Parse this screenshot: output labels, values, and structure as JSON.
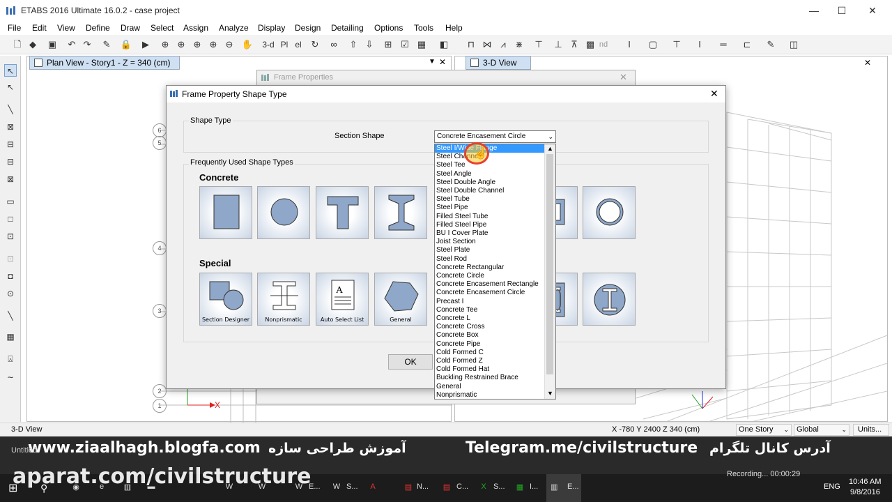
{
  "app": {
    "title": "ETABS 2016 Ultimate 16.0.2 - case project",
    "window_controls": [
      "—",
      "☐",
      "✕"
    ]
  },
  "menu": [
    "File",
    "Edit",
    "View",
    "Define",
    "Draw",
    "Select",
    "Assign",
    "Analyze",
    "Display",
    "Design",
    "Detailing",
    "Options",
    "Tools",
    "Help"
  ],
  "toolbar": {
    "label_3d": "3-d",
    "label_pl": "Pl",
    "label_el": "el",
    "label_nd": "nd"
  },
  "tabs": {
    "plan": "Plan View - Story1 - Z = 340 (cm)",
    "view3d": "3-D View"
  },
  "plan_grid": {
    "bubbles": [
      "6",
      "5",
      "4",
      "3",
      "2",
      "1"
    ],
    "axis_x": "X"
  },
  "frame_properties": {
    "title": "Frame Properties"
  },
  "dialog": {
    "title": "Frame Property Shape Type",
    "group_shape_type": "Shape Type",
    "section_shape_label": "Section Shape",
    "section_shape_value": "Concrete Encasement Circle",
    "group_frequent": "Frequently Used Shape Types",
    "concrete_label": "Concrete",
    "special_label": "Special",
    "special_tiles": [
      "Section Designer",
      "Nonprismatic",
      "Auto Select List",
      "General"
    ],
    "ok_label": "OK"
  },
  "dropdown_options": [
    "Steel I/Wide Flange",
    "Steel Channel",
    "Steel Tee",
    "Steel Angle",
    "Steel Double Angle",
    "Steel Double Channel",
    "Steel Tube",
    "Steel Pipe",
    "Filled Steel Tube",
    "Filled Steel Pipe",
    "BU I Cover Plate",
    "Joist Section",
    "Steel Plate",
    "Steel Rod",
    "Concrete Rectangular",
    "Concrete Circle",
    "Concrete Encasement Rectangle",
    "Concrete Encasement Circle",
    "Precast I",
    "Concrete Tee",
    "Concrete L",
    "Concrete Cross",
    "Concrete Box",
    "Concrete Pipe",
    "Cold Formed C",
    "Cold Formed Z",
    "Cold Formed Hat",
    "Buckling Restrained Brace",
    "General",
    "Nonprismatic"
  ],
  "status": {
    "view": "3-D View",
    "coords": "X -780  Y 2400  Z 340 (cm)",
    "story": "One Story",
    "global": "Global",
    "units": "Units..."
  },
  "overlay": {
    "blog": "www.ziaalhagh.blogfa.com",
    "persian_training": "آموزش طراحی سازه",
    "telegram": "Telegram.me/civilstructure",
    "persian_channel": "آدرس کانال تلگرام",
    "aparat": "aparat.com/civilstructure",
    "untitled": "Untitled"
  },
  "taskbar": {
    "recording": "Recording...  00:00:29",
    "lang": "ENG",
    "time": "10:46 AM",
    "date": "9/8/2016",
    "items": [
      "E...",
      "S...",
      "N...",
      "C...",
      "S...",
      "I...",
      "E..."
    ]
  },
  "colors": {
    "tab_bg": "#cfe0f3",
    "dropdown_highlight": "#3399ff",
    "cursor_highlight": "#e8402a",
    "tile_fill": "#8fa7c8",
    "taskbar_bg": "#1c1c1c"
  }
}
